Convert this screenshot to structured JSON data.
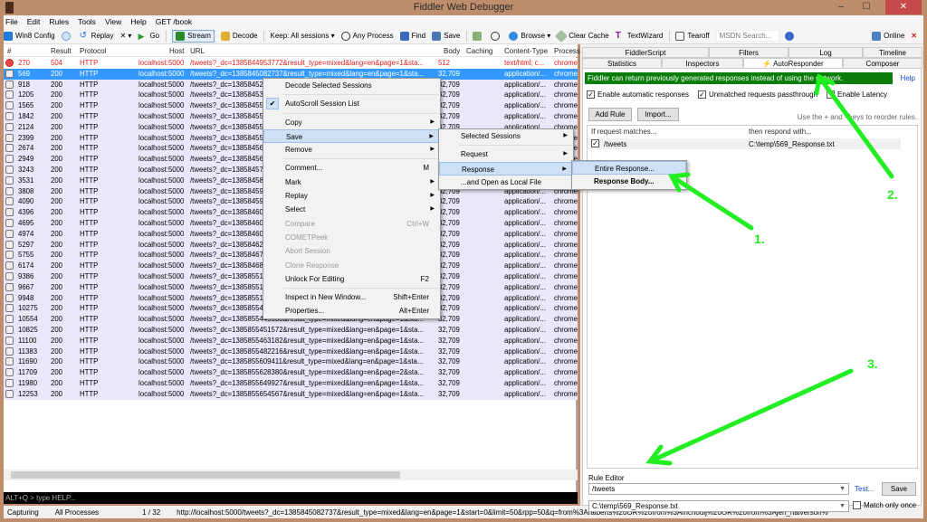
{
  "window": {
    "title": "Fiddler Web Debugger",
    "minimize": "–",
    "maximize": "☐",
    "close": "✕"
  },
  "menu": [
    "File",
    "Edit",
    "Rules",
    "Tools",
    "View",
    "Help",
    "GET /book"
  ],
  "toolbar": {
    "win8config": "Win8 Config",
    "replay": "Replay",
    "remove": "✕ ▾",
    "go": "Go",
    "stream": "Stream",
    "decode": "Decode",
    "keep": "Keep: All sessions ▾",
    "any_process": "Any Process",
    "find": "Find",
    "save": "Save",
    "browse": "Browse ▾",
    "clear_cache": "Clear Cache",
    "textwizard": "TextWizard",
    "tearoff": "Tearoff",
    "msdn_placeholder": "MSDN Search...",
    "online": "Online"
  },
  "sessions": {
    "columns": [
      "#",
      "Result",
      "Protocol",
      "Host",
      "URL",
      "Body",
      "Caching",
      "Content-Type",
      "Process"
    ],
    "rows": [
      {
        "id": "270",
        "result": "504",
        "protocol": "HTTP",
        "host": "localhost:5000",
        "url": "/tweets?_dc=1385844953772&result_type=mixed&lang=en&page=1&sta...",
        "body": "512",
        "type": "text/html; c...",
        "process": "chrome",
        "state": "err"
      },
      {
        "id": "569",
        "result": "200",
        "protocol": "HTTP",
        "host": "localhost:5000",
        "url": "/tweets?_dc=1385845082737&result_type=mixed&lang=en&page=1&sta...",
        "body": "32,709",
        "type": "application/...",
        "process": "chrome",
        "state": "sel"
      },
      {
        "id": "918",
        "result": "200",
        "protocol": "HTTP",
        "host": "localhost:5000",
        "url": "/tweets?_dc=13858452",
        "body": "32,709",
        "type": "application/...",
        "process": "chrome"
      },
      {
        "id": "1205",
        "result": "200",
        "protocol": "HTTP",
        "host": "localhost:5000",
        "url": "/tweets?_dc=13858453",
        "body": "32,709",
        "type": "application/...",
        "process": "chrome"
      },
      {
        "id": "1565",
        "result": "200",
        "protocol": "HTTP",
        "host": "localhost:5000",
        "url": "/tweets?_dc=13858455",
        "body": "32,709",
        "type": "application/...",
        "process": "chrome"
      },
      {
        "id": "1842",
        "result": "200",
        "protocol": "HTTP",
        "host": "localhost:5000",
        "url": "/tweets?_dc=13858455",
        "body": "32,709",
        "type": "application/...",
        "process": "chrome"
      },
      {
        "id": "2124",
        "result": "200",
        "protocol": "HTTP",
        "host": "localhost:5000",
        "url": "/tweets?_dc=13858455",
        "body": "32,709",
        "type": "application/...",
        "process": "chrome"
      },
      {
        "id": "2399",
        "result": "200",
        "protocol": "HTTP",
        "host": "localhost:5000",
        "url": "/tweets?_dc=13858455",
        "body": "32,709",
        "type": "application/...",
        "process": "chrome"
      },
      {
        "id": "2674",
        "result": "200",
        "protocol": "HTTP",
        "host": "localhost:5000",
        "url": "/tweets?_dc=13858456",
        "body": "32,709",
        "type": "application/...",
        "process": "chrome"
      },
      {
        "id": "2949",
        "result": "200",
        "protocol": "HTTP",
        "host": "localhost:5000",
        "url": "/tweets?_dc=13858456",
        "body": "32,709",
        "type": "application/...",
        "process": "chrome"
      },
      {
        "id": "3243",
        "result": "200",
        "protocol": "HTTP",
        "host": "localhost:5000",
        "url": "/tweets?_dc=13858457",
        "body": "32,709",
        "type": "application/...",
        "process": "chrome"
      },
      {
        "id": "3531",
        "result": "200",
        "protocol": "HTTP",
        "host": "localhost:5000",
        "url": "/tweets?_dc=13858458",
        "body": "32,709",
        "type": "application/...",
        "process": "chrome"
      },
      {
        "id": "3808",
        "result": "200",
        "protocol": "HTTP",
        "host": "localhost:5000",
        "url": "/tweets?_dc=13858459",
        "body": "32,709",
        "type": "application/...",
        "process": "chrome"
      },
      {
        "id": "4090",
        "result": "200",
        "protocol": "HTTP",
        "host": "localhost:5000",
        "url": "/tweets?_dc=13858459",
        "body": "32,709",
        "type": "application/...",
        "process": "chrome"
      },
      {
        "id": "4396",
        "result": "200",
        "protocol": "HTTP",
        "host": "localhost:5000",
        "url": "/tweets?_dc=13858460",
        "body": "32,709",
        "type": "application/...",
        "process": "chrome"
      },
      {
        "id": "4695",
        "result": "200",
        "protocol": "HTTP",
        "host": "localhost:5000",
        "url": "/tweets?_dc=13858460",
        "body": "32,709",
        "type": "application/...",
        "process": "chrome"
      },
      {
        "id": "4974",
        "result": "200",
        "protocol": "HTTP",
        "host": "localhost:5000",
        "url": "/tweets?_dc=13858460",
        "body": "32,709",
        "type": "application/...",
        "process": "chrome"
      },
      {
        "id": "5297",
        "result": "200",
        "protocol": "HTTP",
        "host": "localhost:5000",
        "url": "/tweets?_dc=13858462",
        "body": "32,709",
        "type": "application/...",
        "process": "chrome"
      },
      {
        "id": "5755",
        "result": "200",
        "protocol": "HTTP",
        "host": "localhost:5000",
        "url": "/tweets?_dc=13858467",
        "body": "32,709",
        "type": "application/...",
        "process": "chrome"
      },
      {
        "id": "6174",
        "result": "200",
        "protocol": "HTTP",
        "host": "localhost:5000",
        "url": "/tweets?_dc=13858468",
        "body": "32,709",
        "type": "application/...",
        "process": "chrome"
      },
      {
        "id": "9386",
        "result": "200",
        "protocol": "HTTP",
        "host": "localhost:5000",
        "url": "/tweets?_dc=13858551",
        "body": "32,709",
        "type": "application/...",
        "process": "chrome"
      },
      {
        "id": "9667",
        "result": "200",
        "protocol": "HTTP",
        "host": "localhost:5000",
        "url": "/tweets?_dc=13858551",
        "body": "32,709",
        "type": "application/...",
        "process": "chrome"
      },
      {
        "id": "9948",
        "result": "200",
        "protocol": "HTTP",
        "host": "localhost:5000",
        "url": "/tweets?_dc=13858551",
        "body": "32,709",
        "type": "application/...",
        "process": "chrome"
      },
      {
        "id": "10275",
        "result": "200",
        "protocol": "HTTP",
        "host": "localhost:5000",
        "url": "/tweets?_dc=13858554",
        "body": "32,709",
        "type": "application/...",
        "process": "chrome"
      },
      {
        "id": "10554",
        "result": "200",
        "protocol": "HTTP",
        "host": "localhost:5000",
        "url": "/tweets?_dc=1385855449638&result_type=mixed&lang=en&page=1&sta...",
        "body": "32,709",
        "type": "application/...",
        "process": "chrome"
      },
      {
        "id": "10825",
        "result": "200",
        "protocol": "HTTP",
        "host": "localhost:5000",
        "url": "/tweets?_dc=1385855451572&result_type=mixed&lang=en&page=1&sta...",
        "body": "32,709",
        "type": "application/...",
        "process": "chrome"
      },
      {
        "id": "11100",
        "result": "200",
        "protocol": "HTTP",
        "host": "localhost:5000",
        "url": "/tweets?_dc=1385855463182&result_type=mixed&lang=en&page=1&sta...",
        "body": "32,709",
        "type": "application/...",
        "process": "chrome"
      },
      {
        "id": "11383",
        "result": "200",
        "protocol": "HTTP",
        "host": "localhost:5000",
        "url": "/tweets?_dc=1385855482216&result_type=mixed&lang=en&page=1&sta...",
        "body": "32,709",
        "type": "application/...",
        "process": "chrome"
      },
      {
        "id": "11690",
        "result": "200",
        "protocol": "HTTP",
        "host": "localhost:5000",
        "url": "/tweets?_dc=1385855609411&result_type=mixed&lang=en&page=1&sta...",
        "body": "32,709",
        "type": "application/...",
        "process": "chrome"
      },
      {
        "id": "11709",
        "result": "200",
        "protocol": "HTTP",
        "host": "localhost:5000",
        "url": "/tweets?_dc=1385855628380&result_type=mixed&lang=en&page=2&sta...",
        "body": "32,709",
        "type": "application/...",
        "process": "chrome"
      },
      {
        "id": "11980",
        "result": "200",
        "protocol": "HTTP",
        "host": "localhost:5000",
        "url": "/tweets?_dc=1385855649927&result_type=mixed&lang=en&page=1&sta...",
        "body": "32,709",
        "type": "application/...",
        "process": "chrome"
      },
      {
        "id": "12253",
        "result": "200",
        "protocol": "HTTP",
        "host": "localhost:5000",
        "url": "/tweets?_dc=1385855654567&result_type=mixed&lang=en&page=1&sta...",
        "body": "32,709",
        "type": "application/...",
        "process": "chrome"
      }
    ]
  },
  "context_menu": {
    "items": [
      {
        "label": "Decode Selected Sessions"
      },
      {
        "sep": true
      },
      {
        "label": "AutoScroll Session List",
        "checked": true
      },
      {
        "sep": true
      },
      {
        "label": "Copy",
        "submenu": true
      },
      {
        "label": "Save",
        "submenu": true,
        "highlight": true
      },
      {
        "label": "Remove",
        "submenu": true
      },
      {
        "sep": true
      },
      {
        "label": "Comment...",
        "shortcut": "M"
      },
      {
        "label": "Mark",
        "submenu": true
      },
      {
        "label": "Replay",
        "submenu": true
      },
      {
        "label": "Select",
        "submenu": true
      },
      {
        "label": "Compare",
        "shortcut": "Ctrl+W",
        "disabled": true
      },
      {
        "label": "COMETPeek",
        "disabled": true
      },
      {
        "label": "Abort Session",
        "disabled": true
      },
      {
        "label": "Clone Response",
        "disabled": true
      },
      {
        "label": "Unlock For Editing",
        "shortcut": "F2"
      },
      {
        "sep": true
      },
      {
        "label": "Inspect in New Window...",
        "shortcut": "Shift+Enter"
      },
      {
        "label": "Properties...",
        "shortcut": "Alt+Enter"
      }
    ]
  },
  "save_submenu": {
    "items": [
      {
        "label": "Selected Sessions",
        "submenu": true
      },
      {
        "sep": true
      },
      {
        "label": "Request",
        "submenu": true
      },
      {
        "label": "Response",
        "submenu": true,
        "highlight": true
      },
      {
        "label": "...and Open as Local File"
      }
    ]
  },
  "response_submenu": {
    "items": [
      {
        "label": "Entire Response...",
        "highlight": true
      },
      {
        "label": "Response Body...",
        "bold": true
      }
    ]
  },
  "right_tabs": {
    "row1": [
      "FiddlerScript",
      "Filters",
      "Log",
      "Timeline"
    ],
    "row2": [
      "Statistics",
      "Inspectors",
      "AutoResponder",
      "Composer"
    ],
    "active": "AutoResponder"
  },
  "autoresponder": {
    "banner": "Fiddler can return previously generated responses instead of using the network.",
    "help": "Help",
    "enable_auto": "Enable automatic responses",
    "unmatched_passthrough": "Unmatched requests passthrough",
    "enable_latency": "Enable Latency",
    "add_rule": "Add Rule",
    "import": "Import...",
    "hint": "Use the + and - keys to reorder rules.",
    "col_match": "If request matches...",
    "col_respond": "then respond with...",
    "rules": [
      {
        "match": "/tweets",
        "respond": "C:\\temp\\569_Response.txt",
        "enabled": true
      }
    ],
    "rule_editor_label": "Rule Editor",
    "editor_match": "/tweets",
    "editor_respond": "C:\\temp\\569_Response.txt",
    "test": "Test...",
    "save": "Save",
    "match_once": "Match only once"
  },
  "quickexec": {
    "placeholder": "ALT+Q > type HELP..."
  },
  "status": {
    "capturing": "Capturing",
    "processes": "All Processes",
    "count": "1 / 32",
    "url": "http://localhost:5000/tweets?_dc=1385845082737&result_type=mixed&lang=en&page=1&start=0&limit=50&rpp=50&q=from%3Aralberts%20OR%20from%3Amchoulj%20OR%20from%3Ajen_halverson%"
  },
  "annotations": [
    "1.",
    "2.",
    "3."
  ],
  "colors": {
    "banner": "#0a7d0a",
    "selection": "#3399ff",
    "annotation": "#22ee22",
    "error": "#e02020"
  }
}
